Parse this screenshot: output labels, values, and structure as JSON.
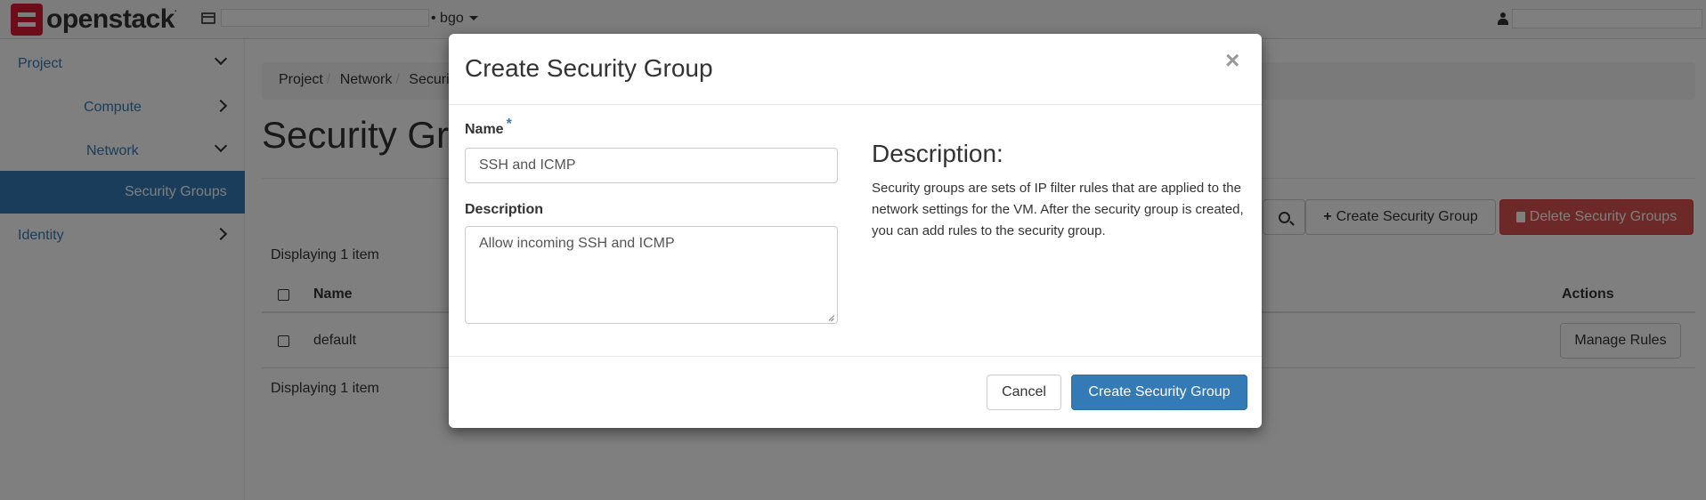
{
  "topbar": {
    "brand": "openstack",
    "brand_dot": ".",
    "project_name": "bgo"
  },
  "sidebar": {
    "items": [
      {
        "label": "Project"
      },
      {
        "label": "Compute"
      },
      {
        "label": "Network"
      },
      {
        "label": "Security Groups"
      },
      {
        "label": "Identity"
      }
    ]
  },
  "main": {
    "breadcrumb": [
      "Project",
      "Network",
      "Security Groups"
    ],
    "title": "Security Groups",
    "create_button": "Create Security Group",
    "delete_button": "Delete Security Groups",
    "displaying_top": "Displaying 1 item",
    "displaying_bottom": "Displaying 1 item",
    "table": {
      "columns": [
        "Name",
        "Actions"
      ],
      "rows": [
        {
          "name": "default",
          "action": "Manage Rules"
        }
      ]
    }
  },
  "modal": {
    "title": "Create Security Group",
    "close": "×",
    "name_label": "Name",
    "required_mark": "*",
    "name_value": "SSH and ICMP",
    "description_label": "Description",
    "description_value": "Allow incoming SSH and ICMP",
    "help_title": "Description:",
    "help_text": "Security groups are sets of IP filter rules that are applied to the network settings for the VM. After the security group is created, you can add rules to the security group.",
    "cancel_button": "Cancel",
    "submit_button": "Create Security Group"
  },
  "colors": {
    "primary": "#337ab7",
    "danger": "#d9534f",
    "brand_red": "#da1a32"
  }
}
